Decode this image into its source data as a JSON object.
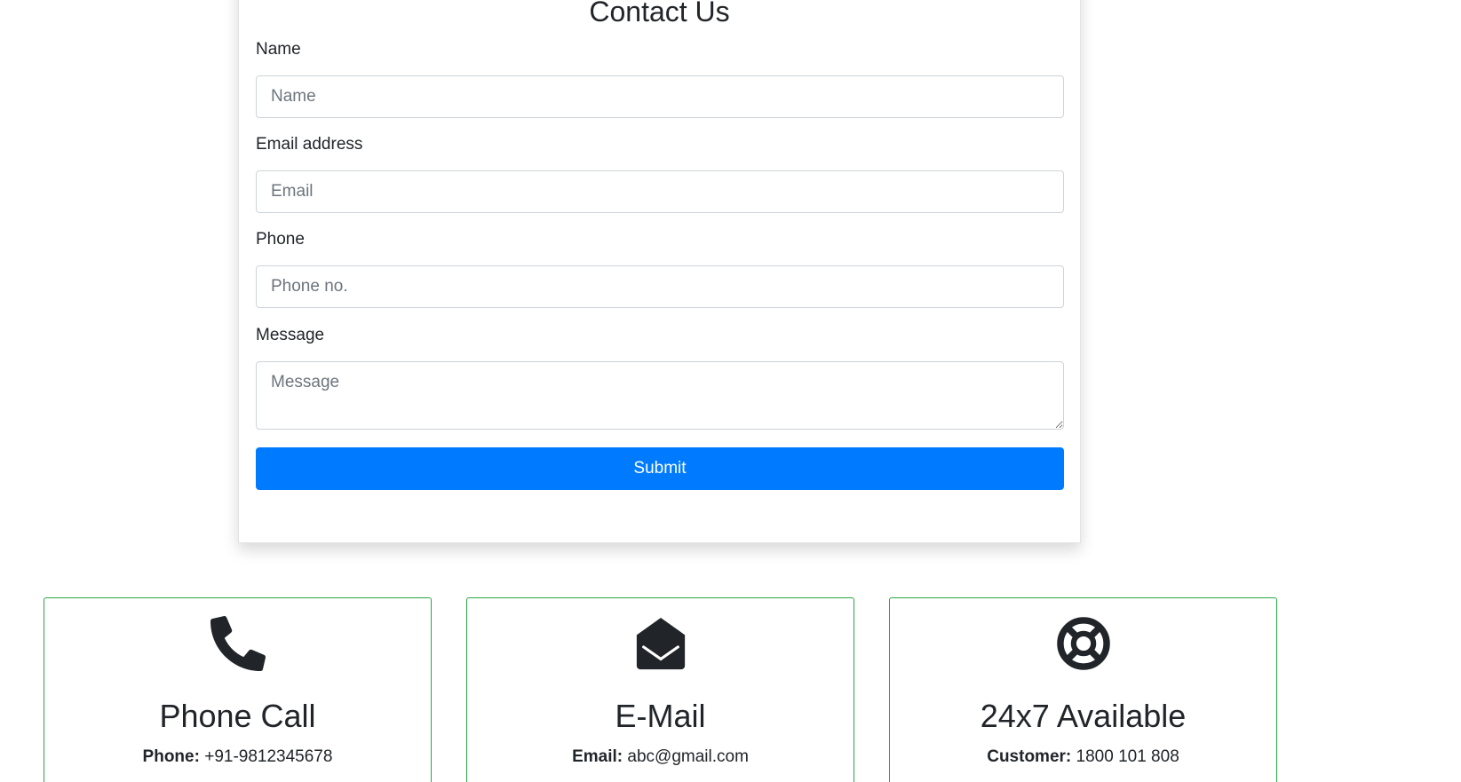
{
  "form": {
    "title": "Contact Us",
    "fields": {
      "name": {
        "label": "Name",
        "placeholder": "Name",
        "value": ""
      },
      "email": {
        "label": "Email address",
        "placeholder": "Email",
        "value": ""
      },
      "phone": {
        "label": "Phone",
        "placeholder": "Phone no.",
        "value": ""
      },
      "message": {
        "label": "Message",
        "placeholder": "Message",
        "value": ""
      }
    },
    "submit_label": "Submit"
  },
  "info_cards": [
    {
      "icon": "phone-icon",
      "title": "Phone Call",
      "key": "Phone:",
      "value": "+91-9812345678"
    },
    {
      "icon": "envelope-open-icon",
      "title": "E-Mail",
      "key": "Email:",
      "value": "abc@gmail.com"
    },
    {
      "icon": "lifebuoy-icon",
      "title": "24x7 Available",
      "key": "Customer:",
      "value": "1800 101 808"
    }
  ],
  "colors": {
    "primary": "#007bff",
    "card_border": "#28a745",
    "text": "#212529"
  }
}
